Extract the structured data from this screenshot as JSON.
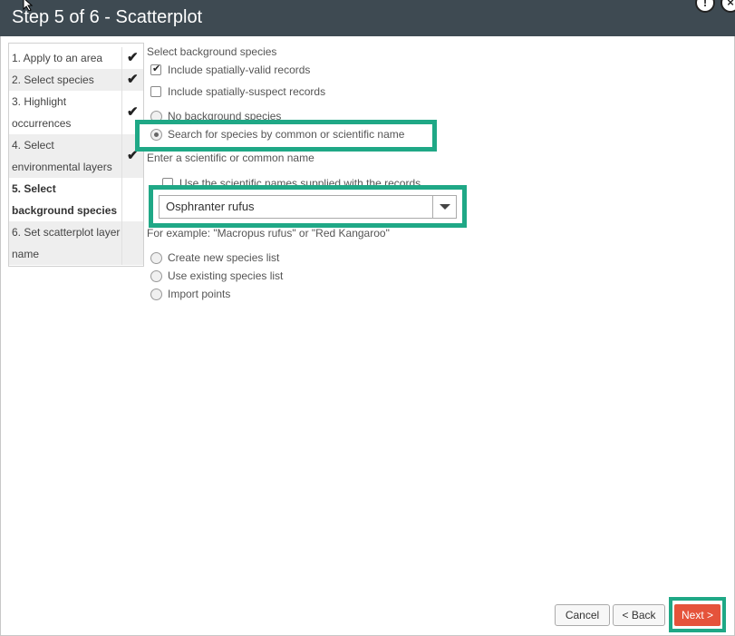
{
  "window": {
    "title": "Step 5 of 6 - Scatterplot",
    "info_icon": "info-icon",
    "close_icon": "close-icon"
  },
  "steps": [
    {
      "label": "1. Apply to an area",
      "done": true
    },
    {
      "label": "2. Select species",
      "done": true
    },
    {
      "label_line1": "3. Highlight",
      "label_line2": "occurrences",
      "done": true
    },
    {
      "label_line1": "4. Select",
      "label_line2": "environmental layers",
      "done": true
    },
    {
      "label_line1": "5. Select",
      "label_line2": "background species",
      "active": true
    },
    {
      "label_line1": "6. Set scatterplot layer",
      "label_line2": "name"
    }
  ],
  "form": {
    "section_label": "Select background species",
    "include_valid": {
      "label": "Include spatially-valid records",
      "checked": true
    },
    "include_suspect": {
      "label": "Include spatially-suspect records",
      "checked": false
    },
    "no_background": {
      "label": "No background species",
      "selected": false
    },
    "search_species": {
      "label": "Search for species by common or scientific name",
      "selected": true
    },
    "enter_name_label": "Enter a scientific or common name",
    "use_sci_names": {
      "label": "Use the scientific names supplied with the records",
      "checked": false
    },
    "species_combo": {
      "value": "Osphranter rufus"
    },
    "example_text": "For example: \"Macropus rufus\" or \"Red Kangaroo\"",
    "create_list": {
      "label": "Create new species list"
    },
    "existing_list": {
      "label": "Use existing species list"
    },
    "import_points": {
      "label": "Import points"
    }
  },
  "buttons": {
    "cancel": "Cancel",
    "back": "< Back",
    "next": "Next >"
  },
  "colors": {
    "titlebar": "#3e4a52",
    "highlight": "#1fa886",
    "next_button": "#e5533b"
  }
}
